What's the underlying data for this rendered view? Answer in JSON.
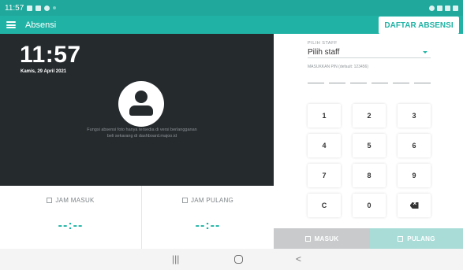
{
  "statusbar": {
    "time": "11:57"
  },
  "appbar": {
    "title": "Absensi",
    "daftar_button": "DAFTAR ABSENSI"
  },
  "left": {
    "clock": "11:57",
    "date": "Kamis, 29 April 2021",
    "notice_line1": "Fungsi absensi foto hanya tersedia di versi berlangganan",
    "notice_line2": "beli sekarang di dashboard.majoo.id"
  },
  "cards": {
    "masuk_label": "JAM MASUK",
    "masuk_value": "--:--",
    "pulang_label": "JAM PULANG",
    "pulang_value": "--:--"
  },
  "staff": {
    "label": "PILIH STAFF",
    "selected": "Pilih staff",
    "pin_label": "MASUKKAN PIN (default: 123456)"
  },
  "keypad": {
    "keys": [
      "1",
      "2",
      "3",
      "4",
      "5",
      "6",
      "7",
      "8",
      "9",
      "C",
      "0"
    ]
  },
  "actions": {
    "masuk": "MASUK",
    "pulang": "PULANG"
  },
  "colors": {
    "accent": "#20b3a5",
    "statusbar": "#1fa89b",
    "dark_panel": "#252a2d",
    "button_disabled": "#c8cacc",
    "button_pulang": "#a9dcd7"
  }
}
